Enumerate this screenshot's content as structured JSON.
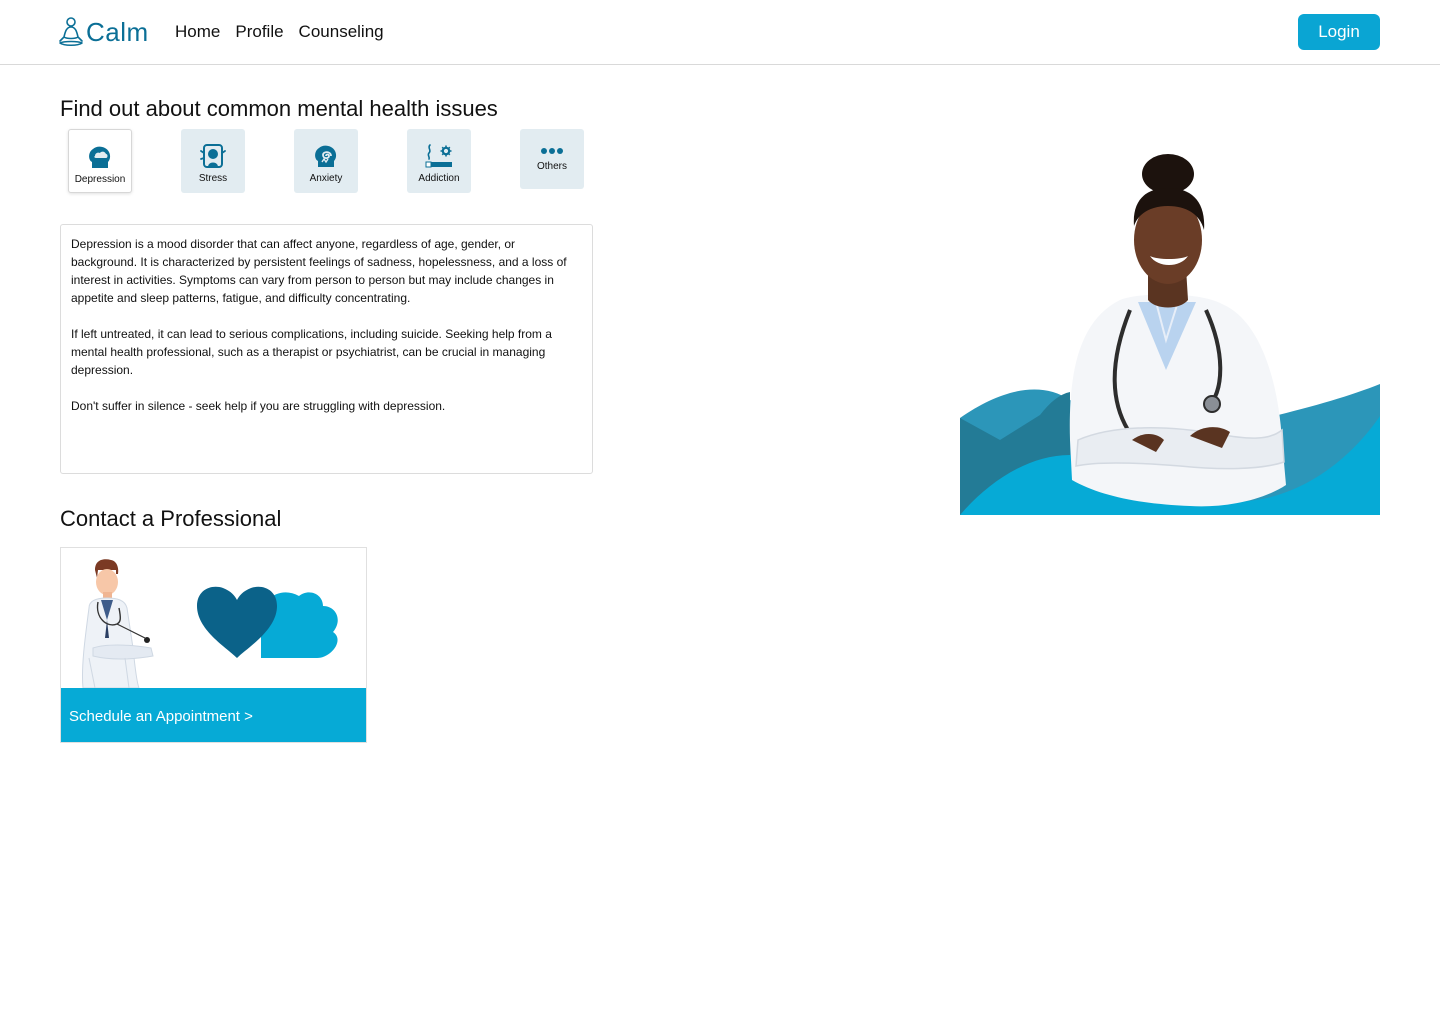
{
  "header": {
    "logo_text": "Calm",
    "nav": [
      "Home",
      "Profile",
      "Counseling"
    ],
    "login_label": "Login"
  },
  "issues": {
    "title": "Find out about common mental health issues",
    "tiles": [
      {
        "label": "Depression",
        "icon": "head-cloud-icon",
        "active": true
      },
      {
        "label": "Stress",
        "icon": "stressed-head-icon",
        "active": false
      },
      {
        "label": "Anxiety",
        "icon": "head-spiral-icon",
        "active": false
      },
      {
        "label": "Addiction",
        "icon": "cigarette-gear-icon",
        "active": false
      },
      {
        "label": "Others",
        "icon": "more-dots-icon",
        "active": false
      }
    ],
    "description": [
      "Depression is a mood disorder that can affect anyone, regardless of age, gender, or background. It is characterized by persistent feelings of sadness, hopelessness, and a loss of interest in activities. Symptoms can vary from person to person but may include changes in appetite and sleep patterns, fatigue, and difficulty concentrating.",
      "If left untreated, it can lead to serious complications, including suicide. Seeking help from a mental health professional, such as a therapist or psychiatrist, can be crucial in managing depression.",
      "Don't suffer in silence - seek help if you are struggling with depression."
    ]
  },
  "contact": {
    "title": "Contact a Professional",
    "appointment_label": "Schedule an Appointment >"
  },
  "colors": {
    "brand": "#0b6f96",
    "accent": "#06aad6",
    "tile_bg": "#e2ecf1"
  }
}
